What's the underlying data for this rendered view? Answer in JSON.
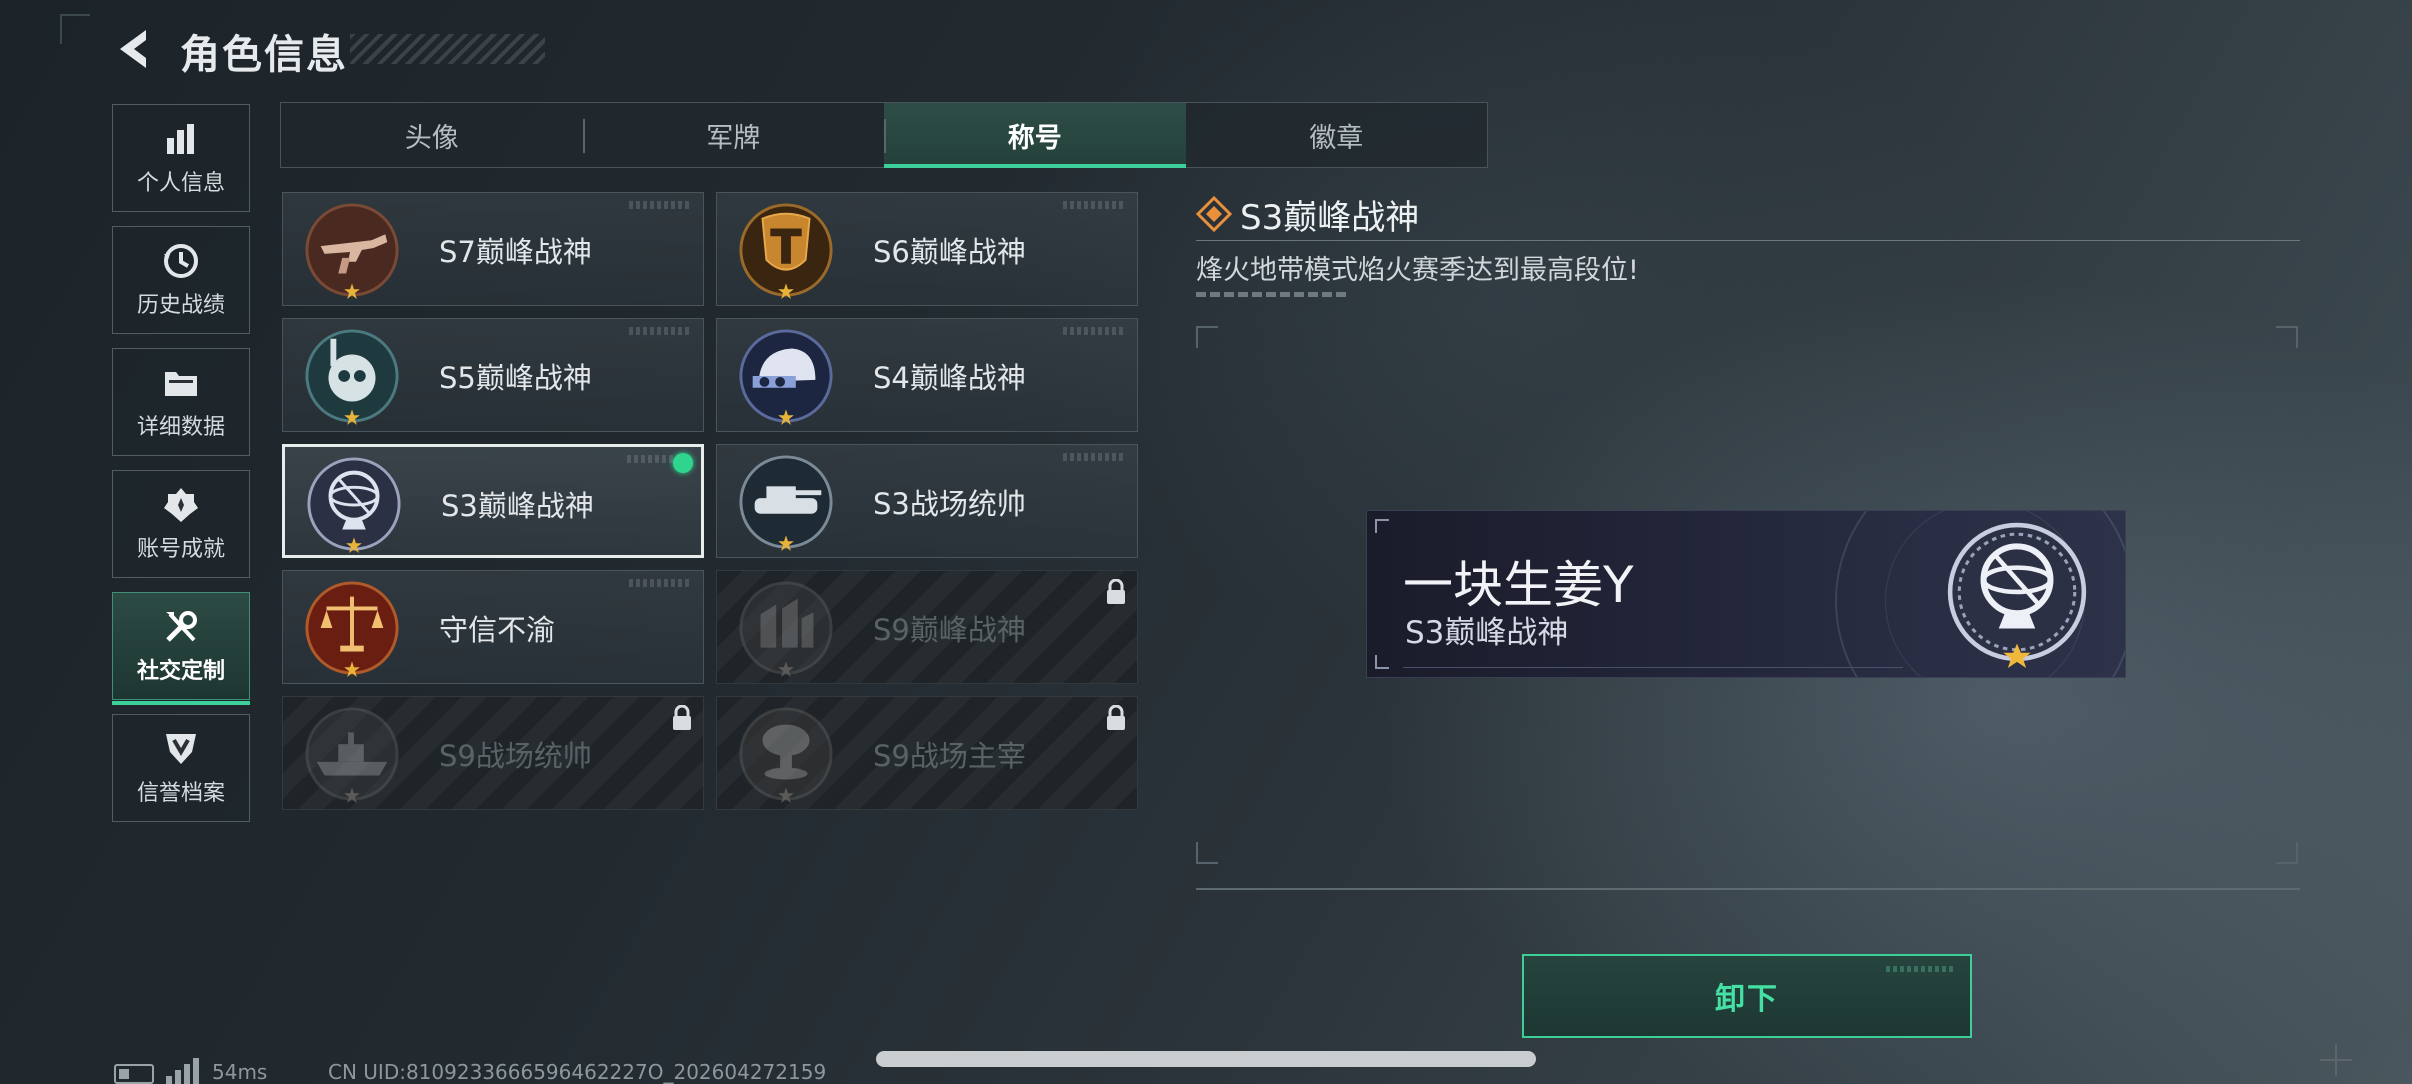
{
  "header": {
    "back_icon": "chevron-left-icon",
    "title": "角色信息"
  },
  "sidebar": {
    "items": [
      {
        "label": "个人信息",
        "icon": "bar-chart-icon",
        "active": false
      },
      {
        "label": "历史战绩",
        "icon": "history-icon",
        "active": false
      },
      {
        "label": "详细数据",
        "icon": "folder-icon",
        "active": false
      },
      {
        "label": "账号成就",
        "icon": "achievement-icon",
        "active": false
      },
      {
        "label": "社交定制",
        "icon": "tools-icon",
        "active": true
      },
      {
        "label": "信誉档案",
        "icon": "shield-badge-icon",
        "active": false
      }
    ]
  },
  "tabs": [
    {
      "label": "头像",
      "active": false
    },
    {
      "label": "军牌",
      "active": false
    },
    {
      "label": "称号",
      "active": true
    },
    {
      "label": "徽章",
      "active": false
    }
  ],
  "titles": [
    {
      "name": "S7巅峰战神",
      "emblem": "rifle-emblem",
      "state": "normal"
    },
    {
      "name": "S6巅峰战神",
      "emblem": "gold-t-emblem",
      "state": "normal"
    },
    {
      "name": "S5巅峰战神",
      "emblem": "skull-diver-emblem",
      "state": "normal"
    },
    {
      "name": "S4巅峰战神",
      "emblem": "helmet-emblem",
      "state": "normal"
    },
    {
      "name": "S3巅峰战神",
      "emblem": "globe-emblem",
      "state": "selected",
      "equipped": true
    },
    {
      "name": "S3战场统帅",
      "emblem": "tank-emblem",
      "state": "normal"
    },
    {
      "name": "守信不渝",
      "emblem": "scales-emblem",
      "state": "normal"
    },
    {
      "name": "S9巅峰战神",
      "emblem": "fortress-emblem",
      "state": "locked"
    },
    {
      "name": "S9战场统帅",
      "emblem": "warship-emblem",
      "state": "locked"
    },
    {
      "name": "S9战场主宰",
      "emblem": "mushroom-cloud-emblem",
      "state": "locked"
    }
  ],
  "detail": {
    "icon": "diamond-rank-icon",
    "title": "S3巅峰战神",
    "description": "烽火地带模式焰火赛季达到最高段位!"
  },
  "nameplate": {
    "player_name": "一块生姜Y",
    "title": "S3巅峰战神"
  },
  "actions": {
    "unequip_label": "卸下"
  },
  "status_bar": {
    "ping": "54ms",
    "uid": "CN UID:8109233666596462227O_202604272159"
  },
  "colors": {
    "accent": "#3ed09a",
    "equipped_dot": "#2fd58e",
    "rank_icon": "#e8903a"
  }
}
